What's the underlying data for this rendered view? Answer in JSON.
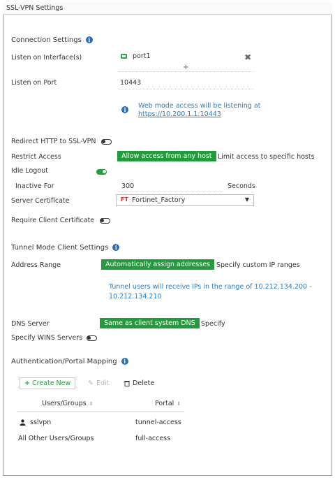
{
  "panel": {
    "title": "SSL-VPN Settings"
  },
  "connection": {
    "heading": "Connection Settings",
    "listen_interface_label": "Listen on Interface(s)",
    "interface_value": "port1",
    "add_symbol": "+",
    "listen_port_label": "Listen on Port",
    "listen_port_value": "10443",
    "web_mode_note": "Web mode access will be listening at",
    "web_mode_url": "https://10.200.1.1:10443"
  },
  "redirect_label": "Redirect HTTP to SSL-VPN",
  "restrict": {
    "label": "Restrict Access",
    "option_selected": "Allow access from any host",
    "option_other": "Limit access to specific hosts"
  },
  "idle": {
    "label": "Idle Logout",
    "inactive_label": "Inactive For",
    "inactive_value": "300",
    "unit": "Seconds"
  },
  "server_cert": {
    "label": "Server Certificate",
    "value": "Fortinet_Factory",
    "badge": "FT"
  },
  "require_client_cert_label": "Require Client Certificate",
  "tunnel": {
    "heading": "Tunnel Mode Client Settings",
    "address_label": "Address Range",
    "option_selected": "Automatically assign addresses",
    "option_other": "Specify custom IP ranges",
    "note_line1": "Tunnel users will receive IPs in the range of 10.212.134.200 -",
    "note_line2": "10.212.134.210"
  },
  "dns": {
    "label": "DNS Server",
    "option_selected": "Same as client system DNS",
    "option_other": "Specify"
  },
  "wins_label": "Specify WINS Servers",
  "auth": {
    "heading": "Authentication/Portal Mapping",
    "create_new": "Create New",
    "edit": "Edit",
    "delete": "Delete",
    "col_users": "Users/Groups",
    "col_portal": "Portal",
    "rows": [
      {
        "user": "sslvpn",
        "portal": "tunnel-access"
      },
      {
        "user": "All Other Users/Groups",
        "portal": "full-access"
      }
    ]
  }
}
